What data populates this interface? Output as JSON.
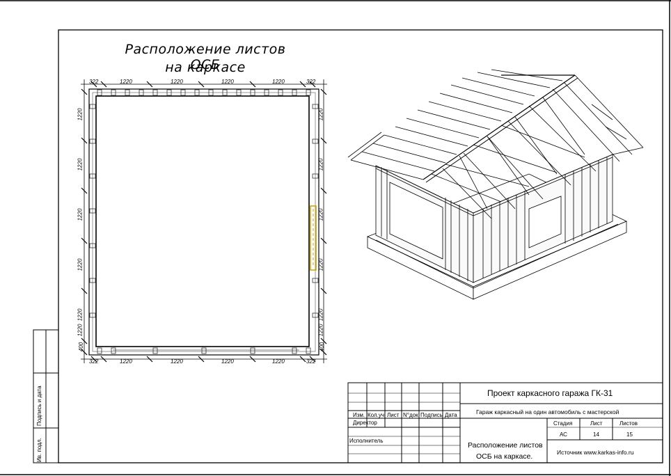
{
  "drawing": {
    "title_line1": "Расположение листов ОСБ",
    "title_line2": "на каркасе",
    "dims_top": [
      "322",
      "1220",
      "1220",
      "1220",
      "1220",
      "322"
    ],
    "dims_bottom": [
      "322",
      "1220",
      "1220",
      "1220",
      "1220",
      "322"
    ],
    "dims_left": [
      "1220",
      "1220",
      "1220",
      "1220",
      "1220",
      "1220",
      "400"
    ],
    "dims_right": [
      "1220",
      "1220",
      "1220",
      "1220",
      "1220",
      "1220",
      "400"
    ]
  },
  "side_stamp": {
    "signature_date": "Подпись и дата",
    "inv_no": "Ив. подл."
  },
  "title_block": {
    "project": "Проект каркасного гаража  ГК-31",
    "description": "Гараж каркасный на один автомобиль с мастерской",
    "col_headers": [
      "Изм.",
      "Кол.уч",
      "Лист",
      "N°док",
      "Подпись",
      "Дата"
    ],
    "role_director": "Директор",
    "role_executor": "Исполнитель",
    "stage_label": "Стадия",
    "sheet_label": "Лист",
    "sheets_label": "Листов",
    "stage": "АС",
    "sheet": "14",
    "sheets": "15",
    "sheet_name_line1": "Расположение листов",
    "sheet_name_line2": "ОСБ на каркасе.",
    "source": "Источник www.karkas-info.ru"
  }
}
